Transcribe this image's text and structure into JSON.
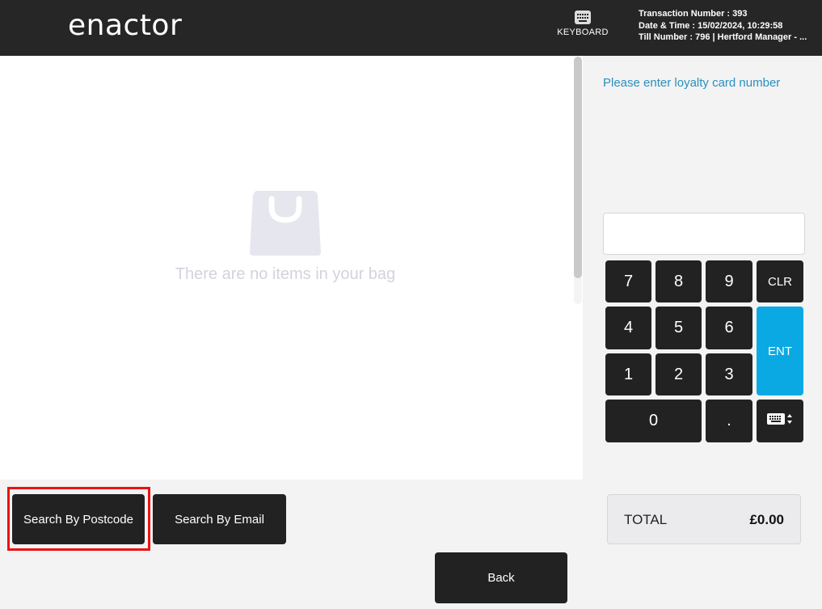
{
  "header": {
    "logo_text": "enactor",
    "keyboard_label": "KEYBOARD",
    "keyboard_icon": "keyboard-icon",
    "transaction_number": "Transaction Number : 393",
    "date_time": "Date & Time : 15/02/2024, 10:29:58",
    "till_number": "Till Number : 796  |  Hertford Manager - ..."
  },
  "bag": {
    "empty_icon": "shopping-bag-icon",
    "empty_text": "There are no items in your bag"
  },
  "entry": {
    "prompt": "Please enter loyalty card number",
    "value": "",
    "placeholder": ""
  },
  "keypad": {
    "k7": "7",
    "k8": "8",
    "k9": "9",
    "clr": "CLR",
    "k4": "4",
    "k5": "5",
    "k6": "6",
    "ent": "ENT",
    "k1": "1",
    "k2": "2",
    "k3": "3",
    "k0": "0",
    "dot": ".",
    "keyboard_toggle_icon": "keyboard-toggle-icon"
  },
  "total": {
    "label": "TOTAL",
    "value": "£0.00"
  },
  "actions": {
    "search_postcode": "Search By Postcode",
    "search_email": "Search By Email",
    "back": "Back"
  },
  "colors": {
    "header_bg": "#262626",
    "accent_blue": "#0ba9e3",
    "prompt_blue": "#2a8fbf",
    "key_bg": "#222222",
    "highlight_red": "#ee1111"
  }
}
